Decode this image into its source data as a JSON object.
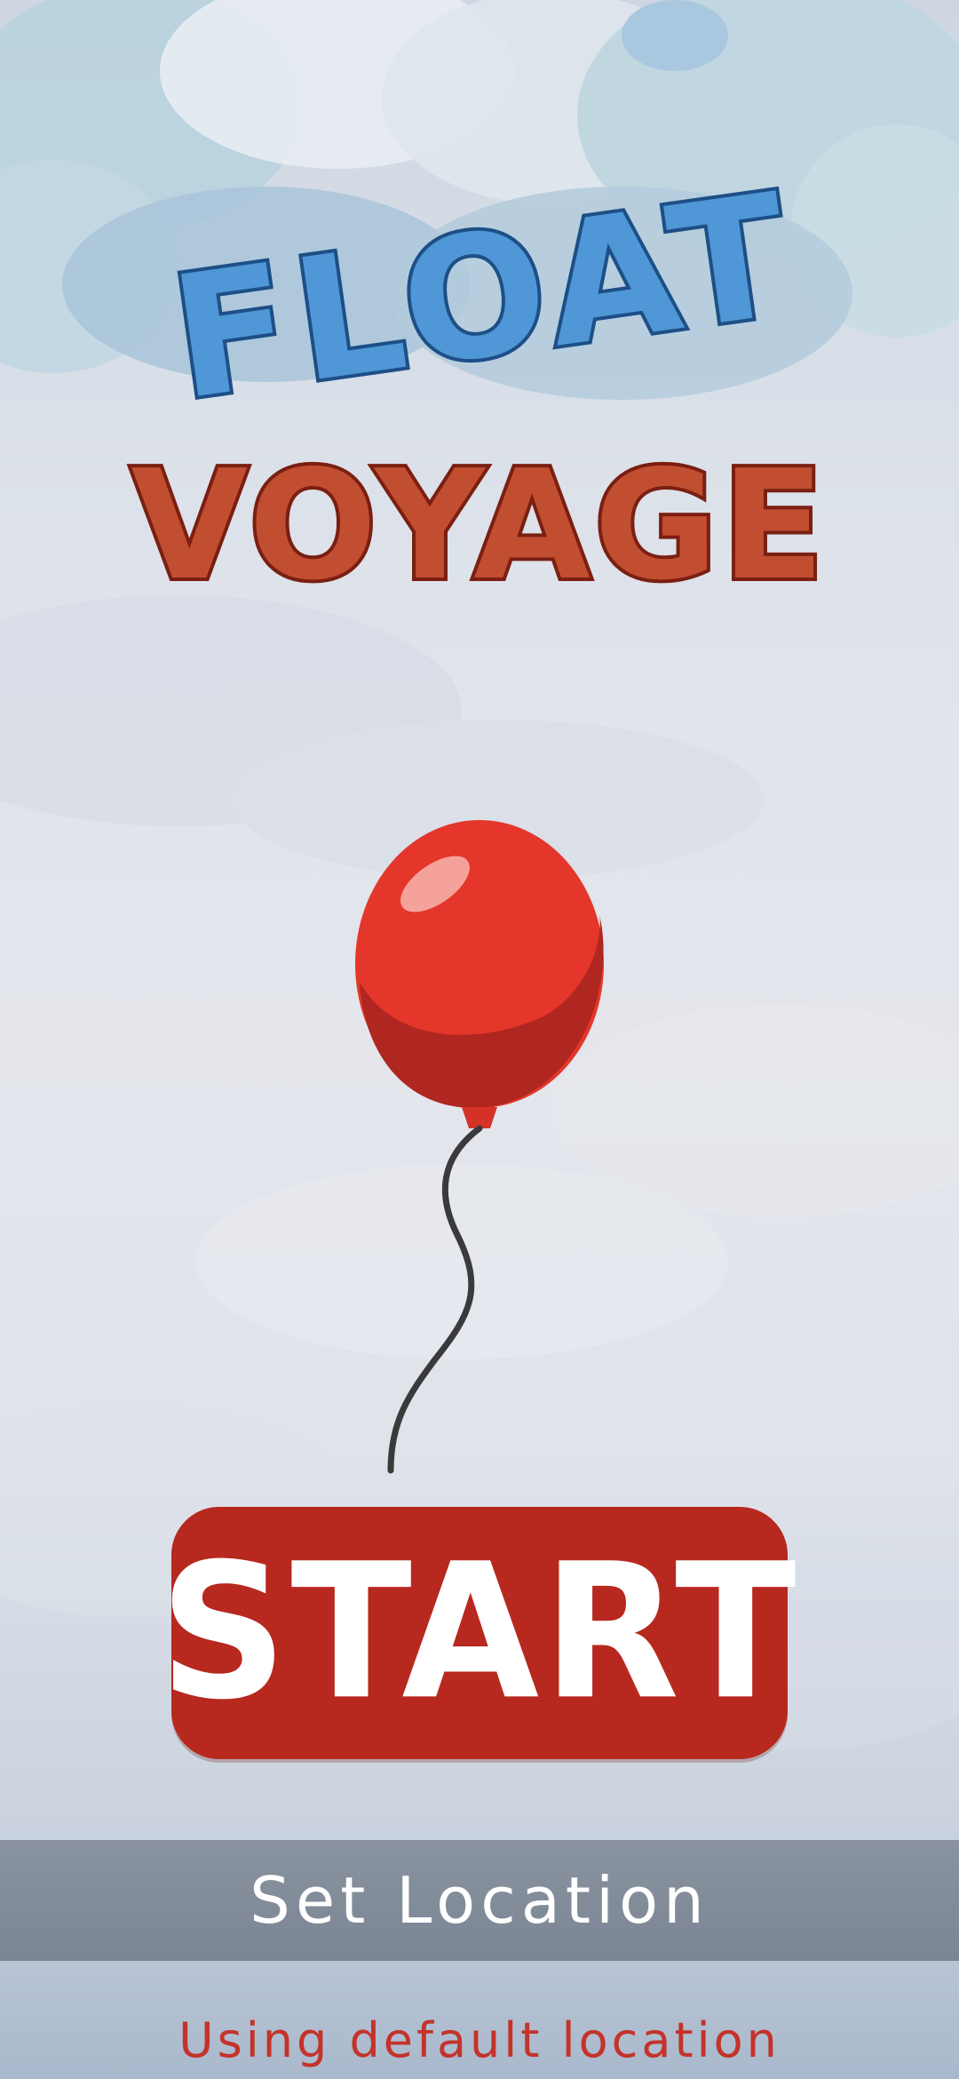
{
  "game": {
    "title_line1": "FLOAT",
    "title_line2": "VOYAGE"
  },
  "start_button": {
    "label": "START"
  },
  "location_button": {
    "label": "Set Location"
  },
  "status": {
    "text": "Using default location"
  },
  "colors": {
    "title_blue": "#4f97d6",
    "title_red": "#c24e31",
    "balloon_red": "#e4362a",
    "start_red": "#b7281f",
    "status_red": "#c4332a"
  }
}
